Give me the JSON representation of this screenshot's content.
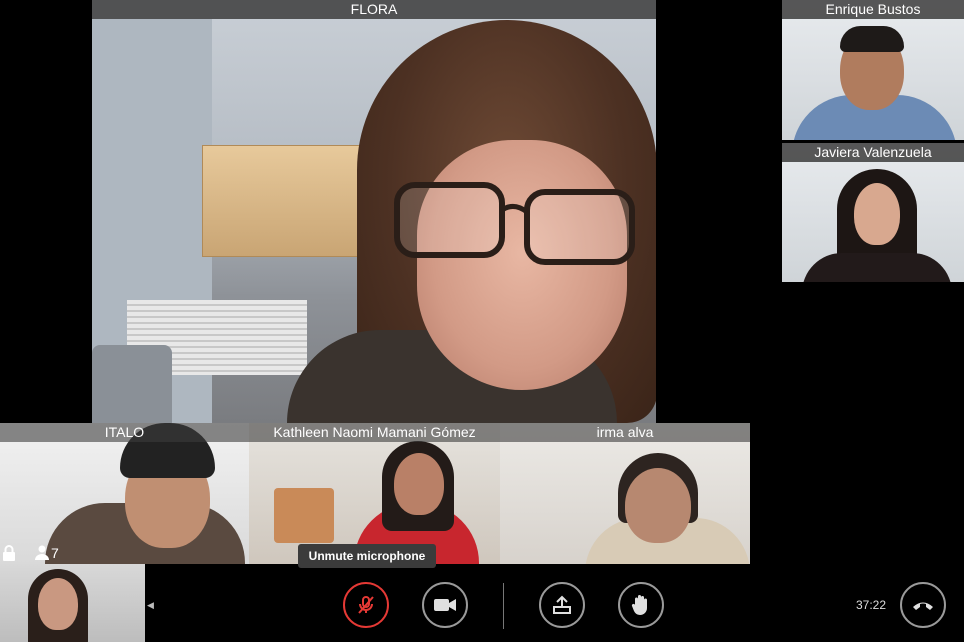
{
  "participants": {
    "main": {
      "name": "FLORA"
    },
    "enrique": {
      "name": "Enrique Bustos"
    },
    "javiera": {
      "name": "Javiera Valenzuela"
    },
    "italo": {
      "name": "ITALO"
    },
    "kathleen": {
      "name": "Kathleen Naomi Mamani Gómez"
    },
    "irma": {
      "name": "irma alva"
    }
  },
  "meeting": {
    "participant_count": "7",
    "elapsed": "37:22"
  },
  "toolbar": {
    "mic_tooltip": "Unmute microphone",
    "mic_state": "muted",
    "icons": [
      "microphone-muted-icon",
      "camera-icon",
      "share-screen-icon",
      "raise-hand-icon",
      "hang-up-icon"
    ]
  },
  "colors": {
    "mic_muted": "#e53935",
    "button_border": "#9a9a9a",
    "namebar": "#3c3c3c"
  }
}
